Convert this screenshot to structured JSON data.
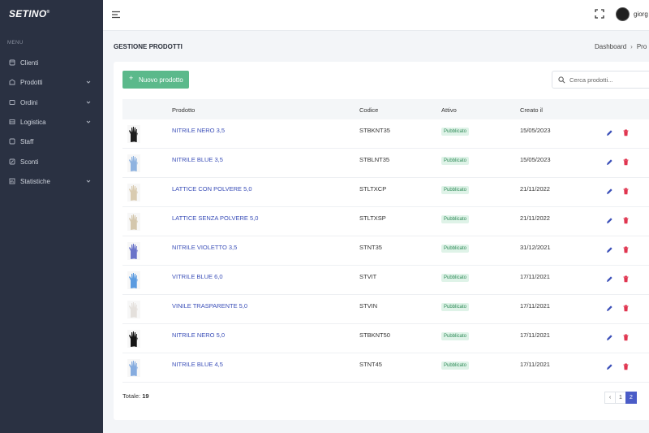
{
  "app": {
    "logo": "SETINO",
    "logo_mark": "®"
  },
  "sidebar": {
    "menu_title": "MENU",
    "items": [
      {
        "label": "Clienti",
        "icon": "clients-icon",
        "has_submenu": false
      },
      {
        "label": "Prodotti",
        "icon": "products-icon",
        "has_submenu": true
      },
      {
        "label": "Ordini",
        "icon": "orders-icon",
        "has_submenu": true
      },
      {
        "label": "Logistica",
        "icon": "logistics-icon",
        "has_submenu": true
      },
      {
        "label": "Staff",
        "icon": "staff-icon",
        "has_submenu": false
      },
      {
        "label": "Sconti",
        "icon": "discount-icon",
        "has_submenu": false
      },
      {
        "label": "Statistiche",
        "icon": "stats-icon",
        "has_submenu": true
      }
    ]
  },
  "topbar": {
    "username": "giorg"
  },
  "page": {
    "title": "GESTIONE PRODOTTI",
    "breadcrumb": {
      "home": "Dashboard",
      "sep": "›",
      "current": "Pro"
    }
  },
  "toolbar": {
    "new_button_plus": "+",
    "new_button_label": "Nuovo prodotto",
    "search_placeholder": "Cerca prodotti..."
  },
  "table": {
    "columns": {
      "product": "Prodotto",
      "code": "Codice",
      "active": "Attivo",
      "created": "Creato il"
    },
    "rows": [
      {
        "name": "NITRILE NERO 3,5",
        "code": "STBKNT35",
        "status": "Pubblicato",
        "date": "15/05/2023",
        "thumb_color": "#1c1c1c"
      },
      {
        "name": "NITRILE BLUE 3,5",
        "code": "STBLNT35",
        "status": "Pubblicato",
        "date": "15/05/2023",
        "thumb_color": "#8fb3e0"
      },
      {
        "name": "LATTICE CON POLVERE 5,0",
        "code": "STLTXCP",
        "status": "Pubblicato",
        "date": "21/11/2022",
        "thumb_color": "#d9cbb0"
      },
      {
        "name": "LATTICE SENZA POLVERE 5,0",
        "code": "STLTXSP",
        "status": "Pubblicato",
        "date": "21/11/2022",
        "thumb_color": "#d4c7ad"
      },
      {
        "name": "NITRILE VIOLETTO 3,5",
        "code": "STNT35",
        "status": "Pubblicato",
        "date": "31/12/2021",
        "thumb_color": "#6a74c9"
      },
      {
        "name": "VITRILE BLUE 6,0",
        "code": "STVIT",
        "status": "Pubblicato",
        "date": "17/11/2021",
        "thumb_color": "#5b9be0"
      },
      {
        "name": "VINILE TRASPARENTE 5,0",
        "code": "STVIN",
        "status": "Pubblicato",
        "date": "17/11/2021",
        "thumb_color": "#e4e0dc"
      },
      {
        "name": "NITRILE NERO 5,0",
        "code": "STBKNT50",
        "status": "Pubblicato",
        "date": "17/11/2021",
        "thumb_color": "#141414"
      },
      {
        "name": "NITRILE BLUE 4,5",
        "code": "STNT45",
        "status": "Pubblicato",
        "date": "17/11/2021",
        "thumb_color": "#86acdf"
      }
    ]
  },
  "footer": {
    "total_label": "Totale:",
    "total_value": "19",
    "pagination": {
      "prev": "‹",
      "pages": [
        "1",
        "2"
      ],
      "current": "2"
    }
  },
  "colors": {
    "sidebar_bg": "#2a3142",
    "primary": "#4a5cc7",
    "success": "#5bb98b",
    "danger": "#e0344f"
  }
}
